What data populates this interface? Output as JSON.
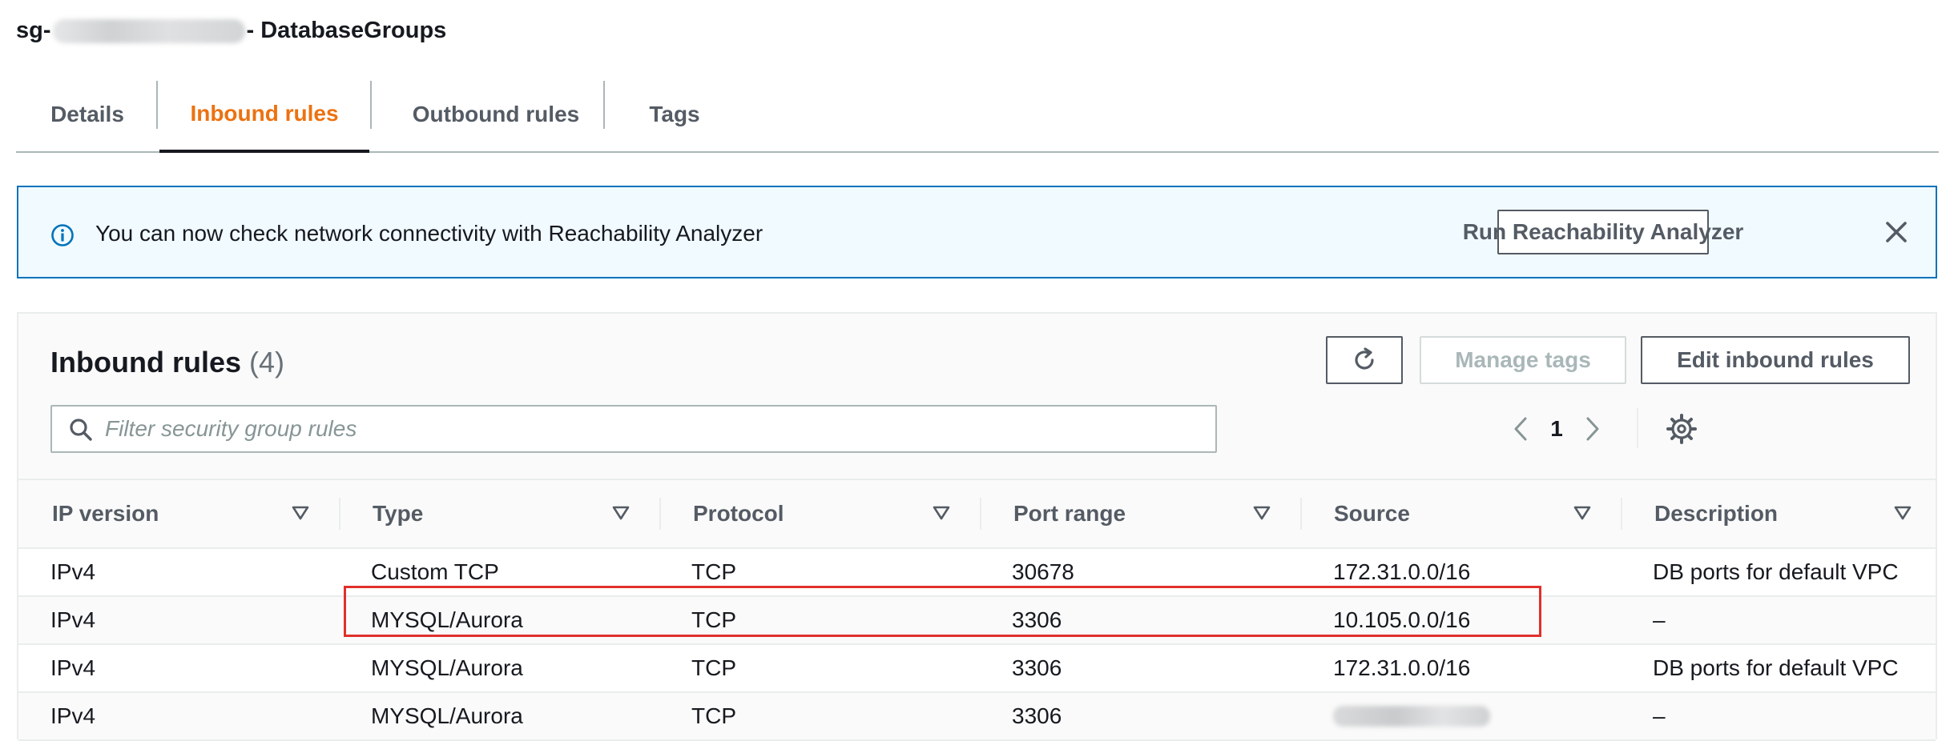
{
  "header": {
    "title_prefix": "sg-",
    "title_suffix": "- DatabaseGroups"
  },
  "tabs": [
    {
      "label": "Details",
      "active": false
    },
    {
      "label": "Inbound rules",
      "active": true
    },
    {
      "label": "Outbound rules",
      "active": false
    },
    {
      "label": "Tags",
      "active": false
    }
  ],
  "flash": {
    "icon": "info-icon",
    "message": "You can now check network connectivity with Reachability Analyzer",
    "button_label": "Run Reachability Analyzer",
    "dismiss_icon": "close-icon"
  },
  "panel": {
    "title": "Inbound rules",
    "count": "(4)",
    "buttons": {
      "refresh_icon": "refresh-icon",
      "manage_tags": "Manage tags",
      "edit_inbound_rules": "Edit inbound rules"
    },
    "filter": {
      "placeholder": "Filter security group rules",
      "value": ""
    },
    "pagination": {
      "current_page": "1"
    }
  },
  "table": {
    "columns": [
      "IP version",
      "Type",
      "Protocol",
      "Port range",
      "Source",
      "Description"
    ],
    "rows": [
      {
        "ip_version": "IPv4",
        "type": "Custom TCP",
        "protocol": "TCP",
        "port_range": "30678",
        "source": "172.31.0.0/16",
        "description": "DB ports for default VPC"
      },
      {
        "ip_version": "IPv4",
        "type": "MYSQL/Aurora",
        "protocol": "TCP",
        "port_range": "3306",
        "source": "10.105.0.0/16",
        "description": "–"
      },
      {
        "ip_version": "IPv4",
        "type": "MYSQL/Aurora",
        "protocol": "TCP",
        "port_range": "3306",
        "source": "172.31.0.0/16",
        "description": "DB ports for default VPC"
      },
      {
        "ip_version": "IPv4",
        "type": "MYSQL/Aurora",
        "protocol": "TCP",
        "port_range": "3306",
        "source": "",
        "description": "–"
      }
    ]
  },
  "colors": {
    "accent_orange": "#ec7211",
    "info_blue": "#0073bb",
    "highlight_red": "#e0302c",
    "text_dark": "#16191f",
    "text_grey": "#545b64"
  }
}
